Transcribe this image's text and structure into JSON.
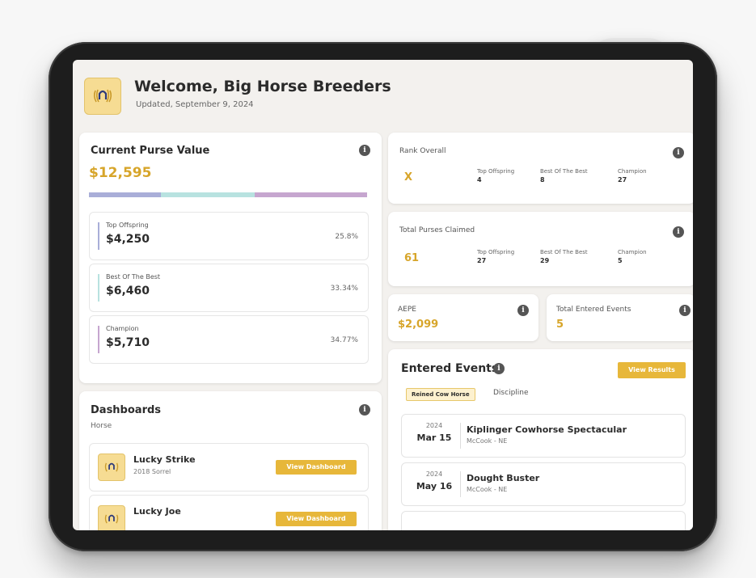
{
  "header": {
    "welcome": "Welcome, Big Horse Breeders",
    "updated": "Updated, September 9, 2024"
  },
  "purse": {
    "title": "Current Purse Value",
    "value": "$12,595",
    "segments": [
      {
        "label": "Top Offspring",
        "amount": "$4,250",
        "percent": "25.8%",
        "color": "#a9aed8"
      },
      {
        "label": "Best Of The Best",
        "amount": "$6,460",
        "percent": "33.34%",
        "color": "#b8e2e0"
      },
      {
        "label": "Champion",
        "amount": "$5,710",
        "percent": "34.77%",
        "color": "#c6a6cf"
      }
    ]
  },
  "rank": {
    "title": "Rank Overall",
    "value": "X",
    "stats": [
      {
        "label": "Top Offspring",
        "value": "4"
      },
      {
        "label": "Best Of The Best",
        "value": "8"
      },
      {
        "label": "Champion",
        "value": "27"
      }
    ]
  },
  "claimed": {
    "title": "Total Purses Claimed",
    "value": "61",
    "stats": [
      {
        "label": "Top Offspring",
        "value": "27"
      },
      {
        "label": "Best Of The Best",
        "value": "29"
      },
      {
        "label": "Champion",
        "value": "5"
      }
    ]
  },
  "aepe": {
    "title": "AEPE",
    "value": "$2,099"
  },
  "entered_total": {
    "title": "Total Entered Events",
    "value": "5"
  },
  "dashboards": {
    "title": "Dashboards",
    "subtitle": "Horse",
    "horses": [
      {
        "name": "Lucky Strike",
        "detail": "2018 Sorrel",
        "button": "View Dashboard"
      },
      {
        "name": "Lucky Joe",
        "detail": "",
        "button": "View Dashboard"
      }
    ]
  },
  "events": {
    "title": "Entered Events",
    "button": "View Results",
    "filter_tag": "Reined Cow Horse",
    "filter_label": "Discipline",
    "items": [
      {
        "year": "2024",
        "date": "Mar 15",
        "name": "Kiplinger Cowhorse Spectacular",
        "location": "McCook - NE"
      },
      {
        "year": "2024",
        "date": "May 16",
        "name": "Dought Buster",
        "location": "McCook - NE"
      }
    ]
  },
  "colors": {
    "accent": "#d7a52a",
    "button": "#e7b73a",
    "logo_bg": "#f6dc93"
  },
  "icons": {
    "info": "info-icon",
    "logo": "laurel-horseshoe-icon"
  }
}
